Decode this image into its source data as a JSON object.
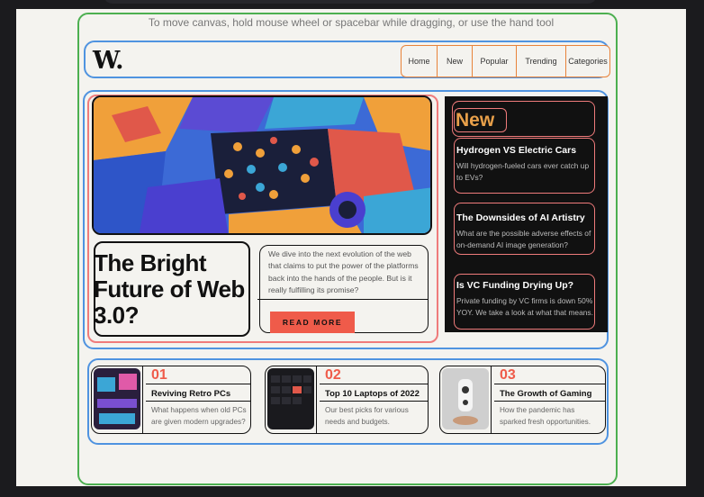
{
  "canvas_hint": "To move canvas, hold mouse wheel or spacebar while dragging, or use the hand tool",
  "logo": "W.",
  "nav": {
    "items": [
      "Home",
      "New",
      "Popular",
      "Trending",
      "Categories"
    ]
  },
  "hero": {
    "title": "The Bright Future of Web 3.0?",
    "description": "We dive into the next evolution of the web that claims to put the power of the platforms back into the hands of the people. But is it really fulfilling its promise?",
    "cta": "READ MORE"
  },
  "sidebar": {
    "label": "New",
    "items": [
      {
        "title": "Hydrogen VS Electric Cars",
        "text": "Will hydrogen-fueled cars ever catch up to EVs?"
      },
      {
        "title": "The Downsides of AI Artistry",
        "text": "What are the possible adverse effects of on-demand AI image generation?"
      },
      {
        "title": "Is VC Funding Drying Up?",
        "text": "Private funding by VC firms is down 50% YOY. We take a look at what that means."
      }
    ]
  },
  "cards": [
    {
      "num": "01",
      "title": "Reviving Retro PCs",
      "text": "What happens when old PCs are given modern upgrades?"
    },
    {
      "num": "02",
      "title": "Top 10 Laptops of 2022",
      "text": "Our best picks for various needs and budgets."
    },
    {
      "num": "03",
      "title": "The Growth of Gaming",
      "text": "How the pandemic has sparked fresh opportunities."
    }
  ],
  "colors": {
    "accent": "#ef5b4a",
    "frame_green": "#4caf50",
    "frame_blue": "#4f93e0",
    "frame_orange": "#e8833a",
    "frame_pink": "#ef7b7b"
  }
}
